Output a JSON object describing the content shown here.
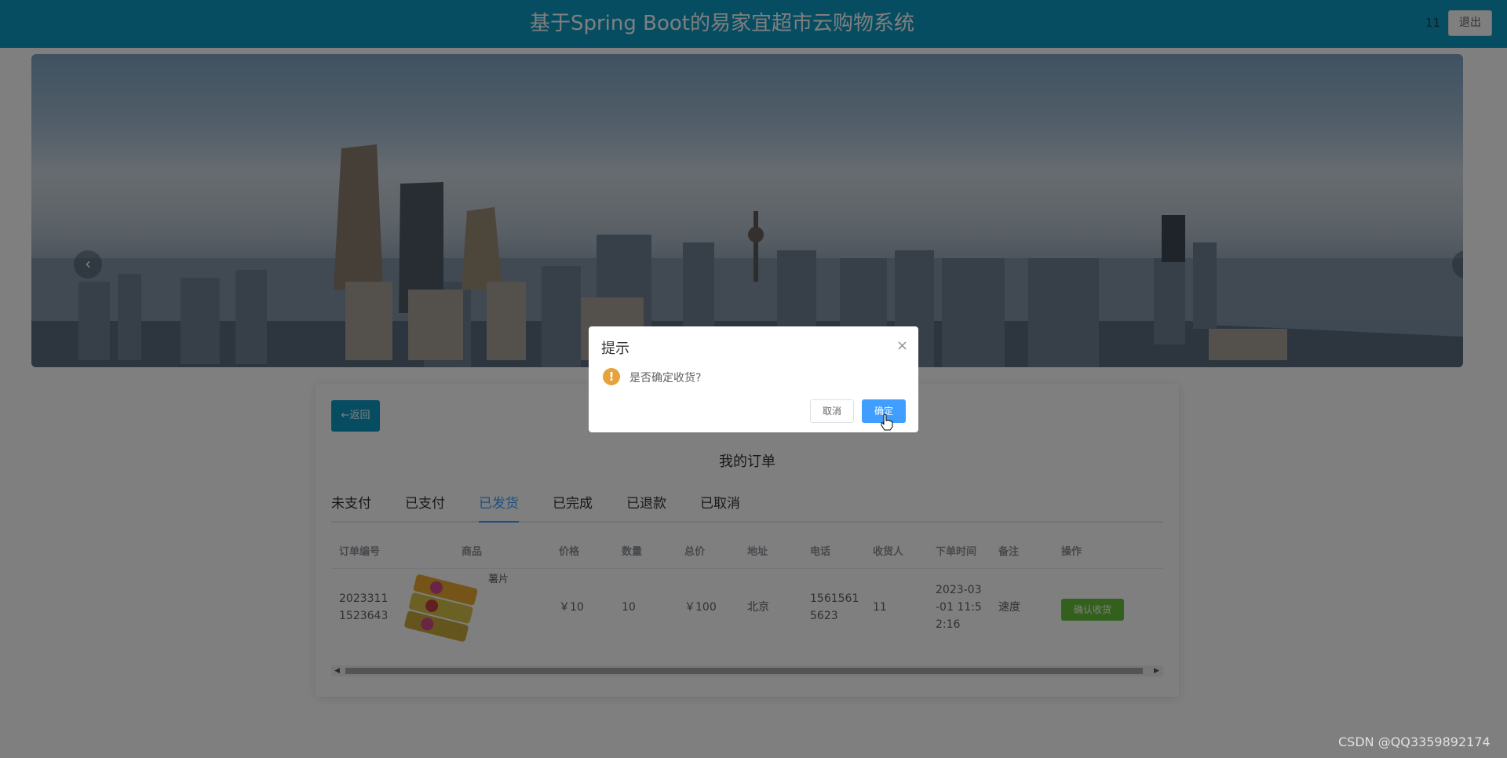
{
  "header": {
    "title": "基于Spring Boot的易家宜超市云购物系统",
    "user": "11",
    "logout_label": "退出"
  },
  "banner": {
    "prev_icon": "‹",
    "next_icon": "›"
  },
  "card": {
    "back_label": "←返回",
    "title": "我的订单",
    "tabs": [
      {
        "label": "未支付"
      },
      {
        "label": "已支付"
      },
      {
        "label": "已发货"
      },
      {
        "label": "已完成"
      },
      {
        "label": "已退款"
      },
      {
        "label": "已取消"
      }
    ],
    "active_tab": "已发货"
  },
  "table": {
    "columns": [
      "订单编号",
      "商品",
      "价格",
      "数量",
      "总价",
      "地址",
      "电话",
      "收货人",
      "下单时间",
      "备注",
      "操作"
    ],
    "rows": [
      {
        "order_no_1": "2023311",
        "order_no_2": "1523643",
        "product_name": "薯片",
        "price": "￥10",
        "quantity": "10",
        "total": "￥100",
        "address": "北京",
        "phone_1": "1561561",
        "phone_2": "5623",
        "receiver": "11",
        "time_1": "2023-03",
        "time_2": "-01 11:5",
        "time_3": "2:16",
        "remark": "速度",
        "action_label": "确认收货"
      }
    ]
  },
  "dialog": {
    "title": "提示",
    "close_icon": "×",
    "warn_icon": "!",
    "message": "是否确定收货?",
    "cancel_label": "取消",
    "ok_label": "确定"
  },
  "watermark": "CSDN @QQ3359892174",
  "colors": {
    "header_bg": "#0e9ac4",
    "active_tab": "#409eff",
    "confirm_btn": "#67c23a",
    "warning": "#e6a23c"
  }
}
